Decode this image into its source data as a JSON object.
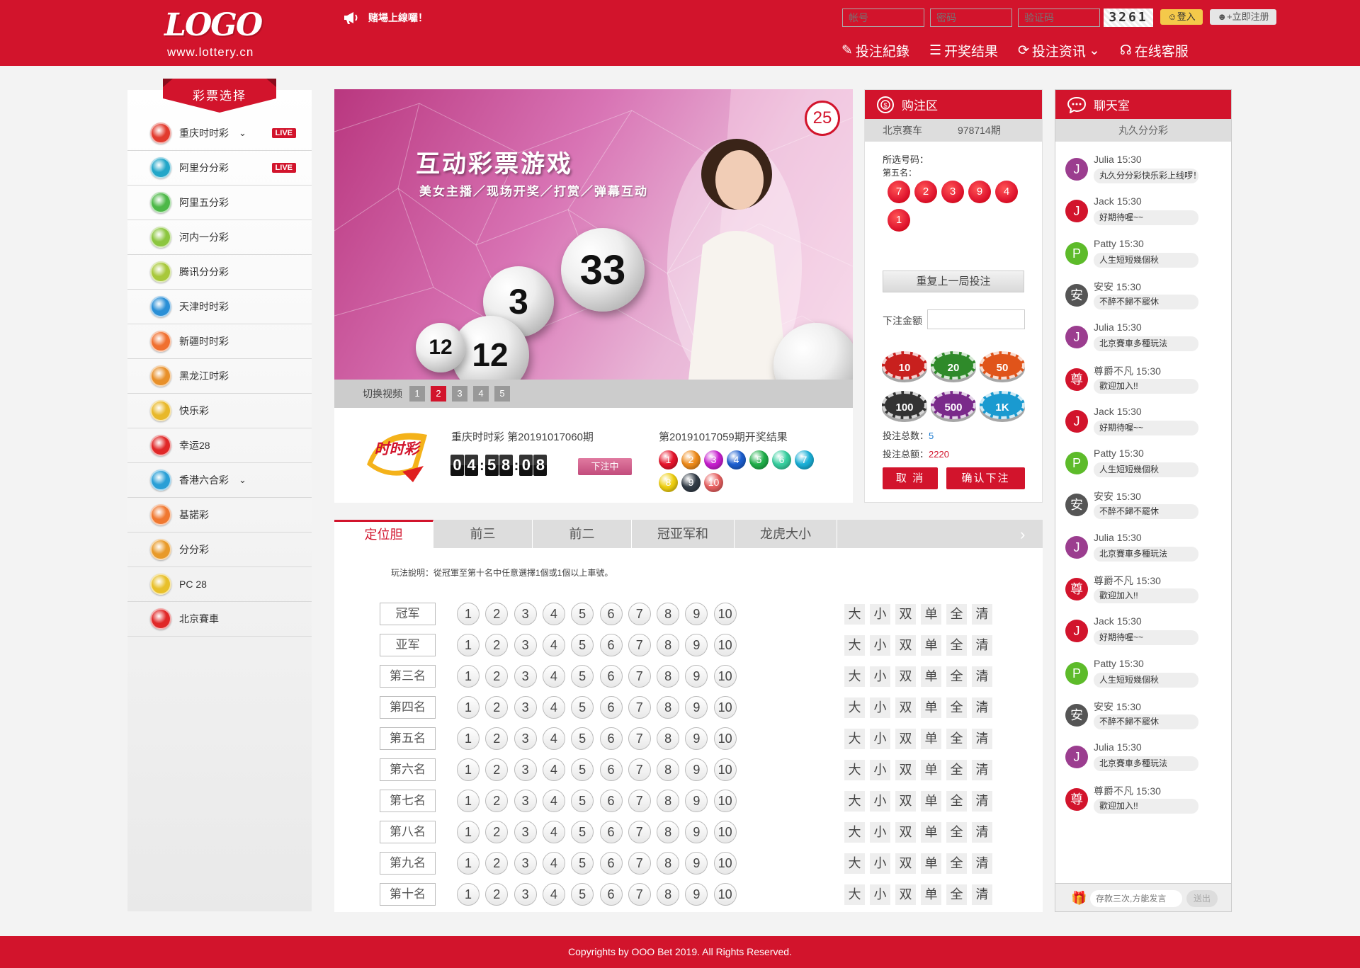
{
  "header": {
    "logo_text": "LOGO",
    "logo_url": "www.lottery.cn",
    "notice": "赌場上線囉！",
    "account_placeholder": "帐号",
    "password_placeholder": "密码",
    "captcha_placeholder": "验证码",
    "captcha_code": "3261",
    "login_label": "登入",
    "register_label": "立即注册",
    "nav": [
      "投注紀錄",
      "开奖结果",
      "投注资讯",
      "在线客服"
    ]
  },
  "sidebar": {
    "title": "彩票选择",
    "items": [
      {
        "name": "重庆时时彩",
        "color": "#e23b2e",
        "chevron": true,
        "live": "LIVE"
      },
      {
        "name": "阿里分分彩",
        "color": "#22a6c8",
        "chevron": false,
        "live": "LIVE"
      },
      {
        "name": "阿里五分彩",
        "color": "#4db848",
        "chevron": false,
        "live": ""
      },
      {
        "name": "河内一分彩",
        "color": "#8cc63f",
        "chevron": false,
        "live": ""
      },
      {
        "name": "腾讯分分彩",
        "color": "#a8c83a",
        "chevron": false,
        "live": ""
      },
      {
        "name": "天津时时彩",
        "color": "#2a8fd6",
        "chevron": false,
        "live": ""
      },
      {
        "name": "新疆时时彩",
        "color": "#f07030",
        "chevron": false,
        "live": ""
      },
      {
        "name": "黑龙江时彩",
        "color": "#e8902a",
        "chevron": false,
        "live": ""
      },
      {
        "name": "快乐彩",
        "color": "#e8b82a",
        "chevron": false,
        "live": ""
      },
      {
        "name": "幸运28",
        "color": "#e02828",
        "chevron": false,
        "live": ""
      },
      {
        "name": "香港六合彩",
        "color": "#2a9fd6",
        "chevron": true,
        "live": ""
      },
      {
        "name": "基諾彩",
        "color": "#f07830",
        "chevron": false,
        "live": ""
      },
      {
        "name": "分分彩",
        "color": "#e89a2a",
        "chevron": false,
        "live": ""
      },
      {
        "name": "PC 28",
        "color": "#e8c02a",
        "chevron": false,
        "live": ""
      },
      {
        "name": "北京賽車",
        "color": "#e02828",
        "chevron": false,
        "live": ""
      }
    ]
  },
  "banner": {
    "title": "互动彩票游戏",
    "subtitle": "美女主播／现场开奖／打赏／弹幕互动",
    "badge": "25",
    "switch_label": "切换视频",
    "video_buttons": [
      "1",
      "2",
      "3",
      "4",
      "5"
    ],
    "active_video": 2
  },
  "draw": {
    "logo_text": "时时彩",
    "current_label": "重庆时时彩 第20191017060期",
    "countdown": [
      "0",
      "4",
      "5",
      "8",
      "0",
      "8"
    ],
    "status_btn": "下注中",
    "last_label": "第20191017059期开奖结果",
    "results": [
      {
        "n": "1",
        "color": "#e8142c"
      },
      {
        "n": "2",
        "color": "#f08c1a"
      },
      {
        "n": "3",
        "color": "#c81ed0"
      },
      {
        "n": "4",
        "color": "#1c5fd0"
      },
      {
        "n": "5",
        "color": "#1fb04a"
      },
      {
        "n": "6",
        "color": "#37d0a0"
      },
      {
        "n": "7",
        "color": "#1ab0d8"
      },
      {
        "n": "8",
        "color": "#f0d010"
      },
      {
        "n": "9",
        "color": "#333d48"
      },
      {
        "n": "10",
        "color": "#e86060"
      }
    ]
  },
  "bet": {
    "title": "购注区",
    "game": "北京赛车",
    "period": "978714期",
    "chosen_label": "所选号码：",
    "position_label": "第五名：",
    "selected": [
      "7",
      "2",
      "3",
      "9",
      "4",
      "1"
    ],
    "repeat_btn": "重复上一局投注",
    "amount_label": "下注金额",
    "chips": [
      {
        "v": "10",
        "color": "#c8201e"
      },
      {
        "v": "20",
        "color": "#2f8a2a"
      },
      {
        "v": "50",
        "color": "#e0541a"
      },
      {
        "v": "100",
        "color": "#333333"
      },
      {
        "v": "500",
        "color": "#7a2a8a"
      },
      {
        "v": "1K",
        "color": "#1a9ad0"
      }
    ],
    "count_label": "投注总数：",
    "count_value": "5",
    "total_label": "投注总额：",
    "total_value": "2220",
    "cancel_btn": "取 消",
    "confirm_btn": "确认下注"
  },
  "chat": {
    "title": "聊天室",
    "room": "丸久分分彩",
    "messages": [
      {
        "initial": "J",
        "color": "#9b3d8f",
        "user": "Julia",
        "time": "15:30",
        "text": "丸久分分彩快乐彩上线啰！"
      },
      {
        "initial": "J",
        "color": "#d2142c",
        "user": "Jack",
        "time": "15:30",
        "text": "好期待喔~~"
      },
      {
        "initial": "P",
        "color": "#5dbb2a",
        "user": "Patty",
        "time": "15:30",
        "text": "人生短短幾個秋"
      },
      {
        "initial": "安",
        "color": "#555555",
        "user": "安安",
        "time": "15:30",
        "text": "不醉不歸不罷休"
      },
      {
        "initial": "J",
        "color": "#9b3d8f",
        "user": "Julia",
        "time": "15:30",
        "text": "北京賽車多種玩法"
      },
      {
        "initial": "尊",
        "color": "#d2142c",
        "user": "尊爵不凡",
        "time": "15:30",
        "text": "歡迎加入!!"
      },
      {
        "initial": "J",
        "color": "#d2142c",
        "user": "Jack",
        "time": "15:30",
        "text": "好期待喔~~"
      },
      {
        "initial": "P",
        "color": "#5dbb2a",
        "user": "Patty",
        "time": "15:30",
        "text": "人生短短幾個秋"
      },
      {
        "initial": "安",
        "color": "#555555",
        "user": "安安",
        "time": "15:30",
        "text": "不醉不歸不罷休"
      },
      {
        "initial": "J",
        "color": "#9b3d8f",
        "user": "Julia",
        "time": "15:30",
        "text": "北京賽車多種玩法"
      },
      {
        "initial": "尊",
        "color": "#d2142c",
        "user": "尊爵不凡",
        "time": "15:30",
        "text": "歡迎加入!!"
      },
      {
        "initial": "J",
        "color": "#d2142c",
        "user": "Jack",
        "time": "15:30",
        "text": "好期待喔~~"
      },
      {
        "initial": "P",
        "color": "#5dbb2a",
        "user": "Patty",
        "time": "15:30",
        "text": "人生短短幾個秋"
      },
      {
        "initial": "安",
        "color": "#555555",
        "user": "安安",
        "time": "15:30",
        "text": "不醉不歸不罷休"
      },
      {
        "initial": "J",
        "color": "#9b3d8f",
        "user": "Julia",
        "time": "15:30",
        "text": "北京賽車多種玩法"
      },
      {
        "initial": "尊",
        "color": "#d2142c",
        "user": "尊爵不凡",
        "time": "15:30",
        "text": "歡迎加入!!"
      }
    ],
    "input_placeholder": "存款三次,方能发言",
    "send_label": "送出"
  },
  "game": {
    "tabs": [
      "定位胆",
      "前三",
      "前二",
      "冠亚军和",
      "龙虎大小"
    ],
    "active_tab": 0,
    "rule": "玩法說明：從冠軍至第十名中任意選擇1個或1個以上車號。",
    "rows": [
      "冠军",
      "亚军",
      "第三名",
      "第四名",
      "第五名",
      "第六名",
      "第七名",
      "第八名",
      "第九名",
      "第十名"
    ],
    "numbers": [
      "1",
      "2",
      "3",
      "4",
      "5",
      "6",
      "7",
      "8",
      "9",
      "10"
    ],
    "quick": [
      "大",
      "小",
      "双",
      "单",
      "全",
      "清"
    ]
  },
  "footer": {
    "text": "Copyrights by OOO Bet 2019. All Rights Reserved."
  },
  "colors": {
    "brand_red": "#d2142c"
  }
}
